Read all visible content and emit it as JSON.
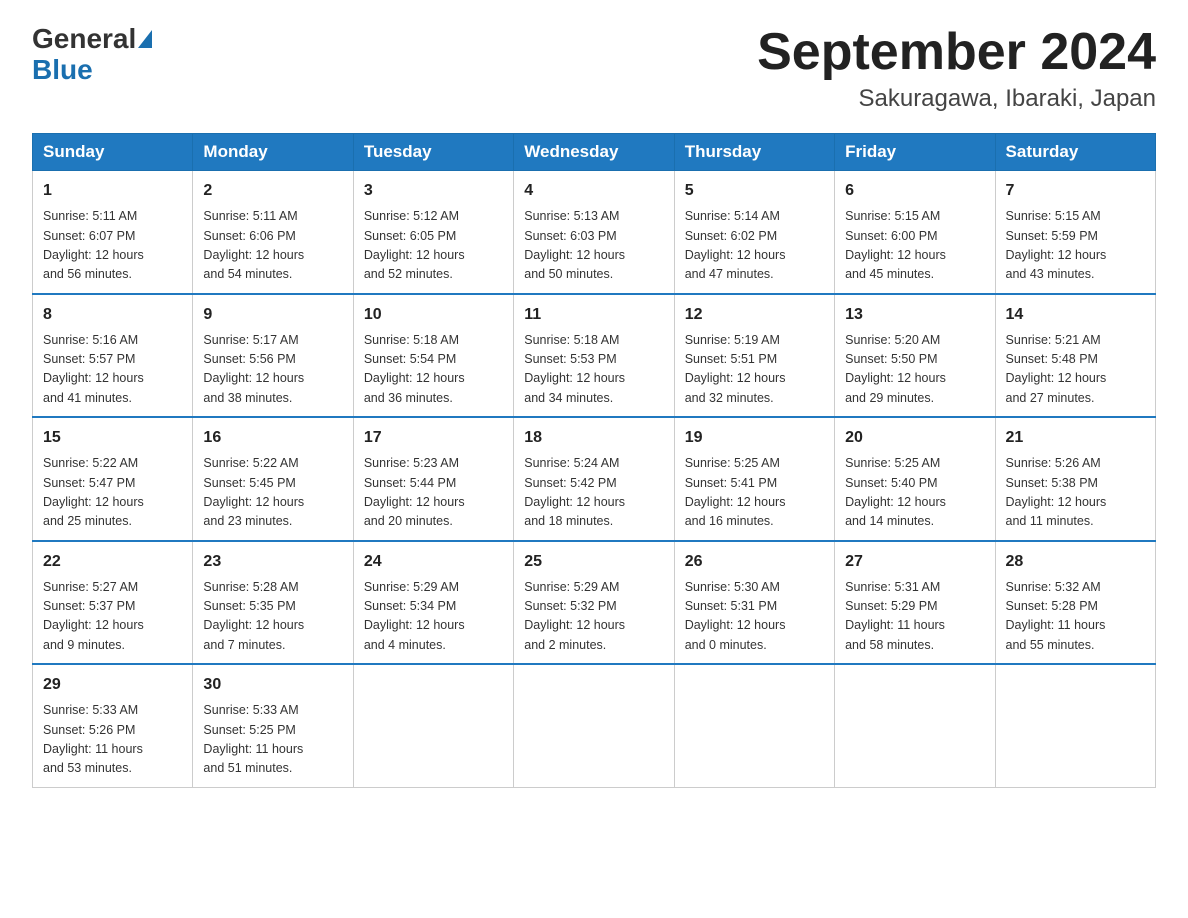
{
  "logo": {
    "general": "General",
    "blue": "Blue"
  },
  "header": {
    "month_year": "September 2024",
    "location": "Sakuragawa, Ibaraki, Japan"
  },
  "weekdays": [
    "Sunday",
    "Monday",
    "Tuesday",
    "Wednesday",
    "Thursday",
    "Friday",
    "Saturday"
  ],
  "weeks": [
    [
      {
        "day": "1",
        "sunrise": "5:11 AM",
        "sunset": "6:07 PM",
        "daylight": "12 hours and 56 minutes."
      },
      {
        "day": "2",
        "sunrise": "5:11 AM",
        "sunset": "6:06 PM",
        "daylight": "12 hours and 54 minutes."
      },
      {
        "day": "3",
        "sunrise": "5:12 AM",
        "sunset": "6:05 PM",
        "daylight": "12 hours and 52 minutes."
      },
      {
        "day": "4",
        "sunrise": "5:13 AM",
        "sunset": "6:03 PM",
        "daylight": "12 hours and 50 minutes."
      },
      {
        "day": "5",
        "sunrise": "5:14 AM",
        "sunset": "6:02 PM",
        "daylight": "12 hours and 47 minutes."
      },
      {
        "day": "6",
        "sunrise": "5:15 AM",
        "sunset": "6:00 PM",
        "daylight": "12 hours and 45 minutes."
      },
      {
        "day": "7",
        "sunrise": "5:15 AM",
        "sunset": "5:59 PM",
        "daylight": "12 hours and 43 minutes."
      }
    ],
    [
      {
        "day": "8",
        "sunrise": "5:16 AM",
        "sunset": "5:57 PM",
        "daylight": "12 hours and 41 minutes."
      },
      {
        "day": "9",
        "sunrise": "5:17 AM",
        "sunset": "5:56 PM",
        "daylight": "12 hours and 38 minutes."
      },
      {
        "day": "10",
        "sunrise": "5:18 AM",
        "sunset": "5:54 PM",
        "daylight": "12 hours and 36 minutes."
      },
      {
        "day": "11",
        "sunrise": "5:18 AM",
        "sunset": "5:53 PM",
        "daylight": "12 hours and 34 minutes."
      },
      {
        "day": "12",
        "sunrise": "5:19 AM",
        "sunset": "5:51 PM",
        "daylight": "12 hours and 32 minutes."
      },
      {
        "day": "13",
        "sunrise": "5:20 AM",
        "sunset": "5:50 PM",
        "daylight": "12 hours and 29 minutes."
      },
      {
        "day": "14",
        "sunrise": "5:21 AM",
        "sunset": "5:48 PM",
        "daylight": "12 hours and 27 minutes."
      }
    ],
    [
      {
        "day": "15",
        "sunrise": "5:22 AM",
        "sunset": "5:47 PM",
        "daylight": "12 hours and 25 minutes."
      },
      {
        "day": "16",
        "sunrise": "5:22 AM",
        "sunset": "5:45 PM",
        "daylight": "12 hours and 23 minutes."
      },
      {
        "day": "17",
        "sunrise": "5:23 AM",
        "sunset": "5:44 PM",
        "daylight": "12 hours and 20 minutes."
      },
      {
        "day": "18",
        "sunrise": "5:24 AM",
        "sunset": "5:42 PM",
        "daylight": "12 hours and 18 minutes."
      },
      {
        "day": "19",
        "sunrise": "5:25 AM",
        "sunset": "5:41 PM",
        "daylight": "12 hours and 16 minutes."
      },
      {
        "day": "20",
        "sunrise": "5:25 AM",
        "sunset": "5:40 PM",
        "daylight": "12 hours and 14 minutes."
      },
      {
        "day": "21",
        "sunrise": "5:26 AM",
        "sunset": "5:38 PM",
        "daylight": "12 hours and 11 minutes."
      }
    ],
    [
      {
        "day": "22",
        "sunrise": "5:27 AM",
        "sunset": "5:37 PM",
        "daylight": "12 hours and 9 minutes."
      },
      {
        "day": "23",
        "sunrise": "5:28 AM",
        "sunset": "5:35 PM",
        "daylight": "12 hours and 7 minutes."
      },
      {
        "day": "24",
        "sunrise": "5:29 AM",
        "sunset": "5:34 PM",
        "daylight": "12 hours and 4 minutes."
      },
      {
        "day": "25",
        "sunrise": "5:29 AM",
        "sunset": "5:32 PM",
        "daylight": "12 hours and 2 minutes."
      },
      {
        "day": "26",
        "sunrise": "5:30 AM",
        "sunset": "5:31 PM",
        "daylight": "12 hours and 0 minutes."
      },
      {
        "day": "27",
        "sunrise": "5:31 AM",
        "sunset": "5:29 PM",
        "daylight": "11 hours and 58 minutes."
      },
      {
        "day": "28",
        "sunrise": "5:32 AM",
        "sunset": "5:28 PM",
        "daylight": "11 hours and 55 minutes."
      }
    ],
    [
      {
        "day": "29",
        "sunrise": "5:33 AM",
        "sunset": "5:26 PM",
        "daylight": "11 hours and 53 minutes."
      },
      {
        "day": "30",
        "sunrise": "5:33 AM",
        "sunset": "5:25 PM",
        "daylight": "11 hours and 51 minutes."
      },
      null,
      null,
      null,
      null,
      null
    ]
  ],
  "labels": {
    "sunrise": "Sunrise:",
    "sunset": "Sunset:",
    "daylight": "Daylight:"
  }
}
